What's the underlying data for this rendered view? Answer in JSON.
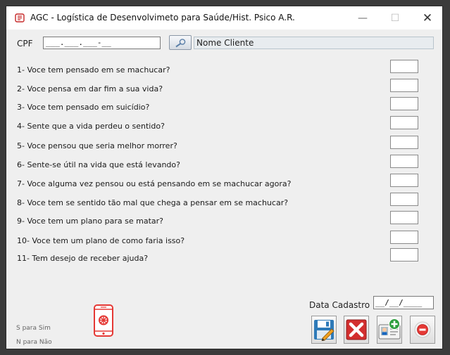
{
  "window": {
    "title": "AGC - Logística de Desenvolvimeto para Saúde/Hist. Psico A.R.",
    "controls": {
      "minimize": "—",
      "maximize": "☐",
      "close": "✕"
    }
  },
  "cpf": {
    "label": "CPF",
    "value": "___.___.___-__"
  },
  "client": {
    "name": "Nome Cliente"
  },
  "questions": [
    "1- Voce tem pensado em se machucar?",
    "2- Voce pensa em dar fim a sua vida?",
    "3- Voce tem pensado em suicídio?",
    "4- Sente que a vida perdeu o sentido?",
    "5- Voce pensou que seria melhor morrer?",
    "6- Sente-se útil na vida que está levando?",
    "7- Voce alguma vez pensou ou está pensando em se machucar agora?",
    "8- Voce tem se sentido tão mal que chega a pensar em se machucar?",
    "9- Voce tem um plano para se matar?",
    "10- Voce tem um plano de como faria isso?",
    "11- Tem desejo de receber ajuda?"
  ],
  "date": {
    "label": "Data Cadastro",
    "value": "__/__/____"
  },
  "hints": {
    "yes": "S para Sim",
    "no": "N para Não"
  },
  "icons": {
    "app": "app-logo-icon",
    "search": "search-icon",
    "phone": "mobile-phone-icon",
    "save": "save-icon",
    "delete": "delete-icon",
    "add_user": "add-user-icon",
    "exit": "exit-icon"
  }
}
